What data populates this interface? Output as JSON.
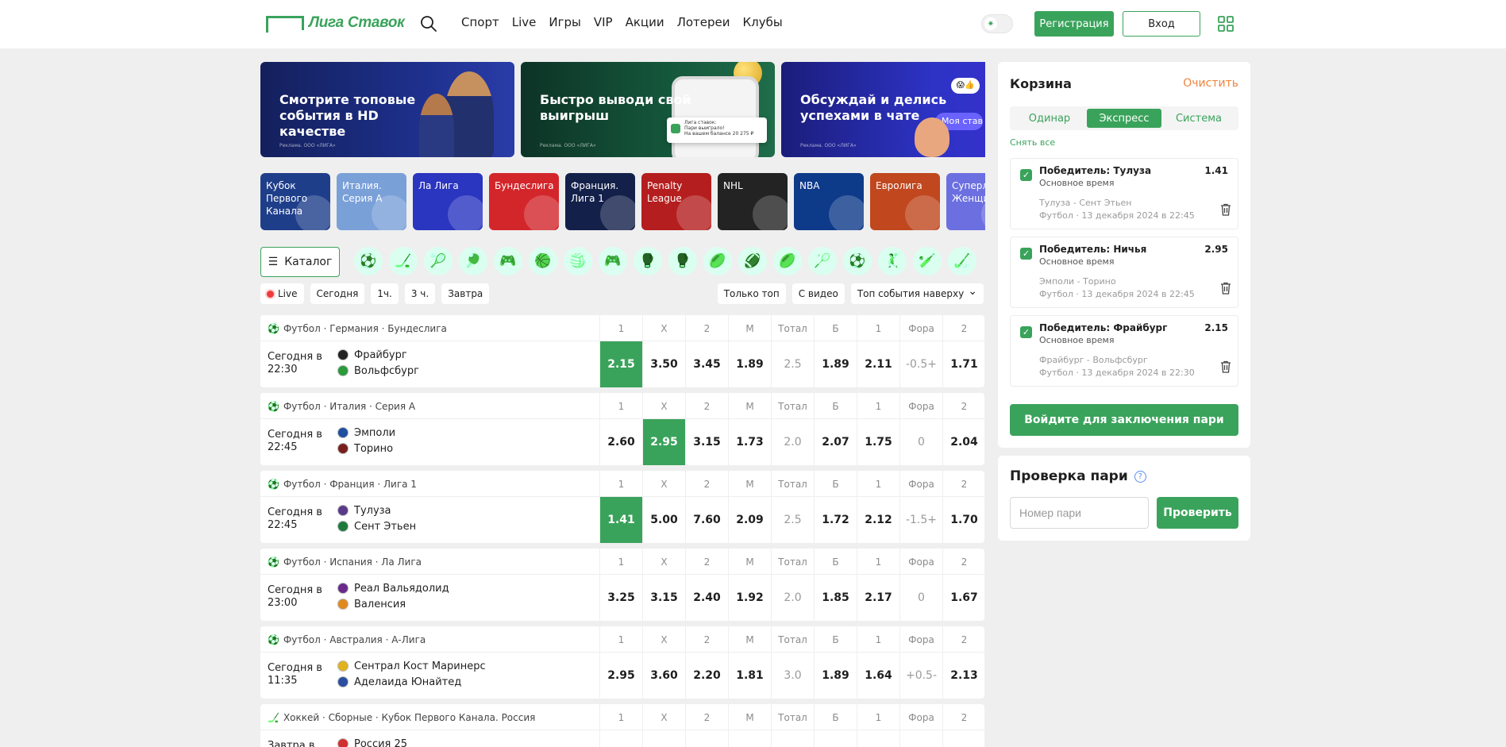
{
  "brand": {
    "logo_text": "Лига Ставок",
    "accent": "#3aa35b"
  },
  "nav": [
    "Спорт",
    "Live",
    "Игры",
    "VIP",
    "Акции",
    "Лотереи",
    "Клубы"
  ],
  "header": {
    "register": "Регистрация",
    "login": "Вход"
  },
  "banners": [
    {
      "title": "Смотрите топовые события в HD качестве",
      "ad": "Реклама. ООО «ЛИГА»"
    },
    {
      "title": "Быстро выводи свой выигрыш",
      "ad": "Реклама. ООО «ЛИГА»",
      "card": [
        "Лига ставок:",
        "Пари выиграло!",
        "На вашем балансе 20 275 ₽"
      ]
    },
    {
      "title": "Обсуждай и делись успехами в чате",
      "ad": "Реклама. ООО «ЛИГА»",
      "chat": "Моя ставка"
    }
  ],
  "leagues": [
    {
      "name": "Кубок Первого Канала",
      "color": "#1f3e8a"
    },
    {
      "name": "Италия. Серия А",
      "color": "#7aa0d8"
    },
    {
      "name": "Ла Лига",
      "color": "#2a35c0"
    },
    {
      "name": "Бундеслига",
      "color": "#d3262b"
    },
    {
      "name": "Франция. Лига 1",
      "color": "#13204a"
    },
    {
      "name": "Penalty League",
      "color": "#b51e1e"
    },
    {
      "name": "NHL",
      "color": "#232323"
    },
    {
      "name": "NBA",
      "color": "#0e3a8a"
    },
    {
      "name": "Евролига",
      "color": "#c0471e"
    },
    {
      "name": "Суперлига. Женщины",
      "color": "#6b6fe0"
    }
  ],
  "catalog": "Каталог",
  "sport_icons": [
    "football-icon",
    "hockey-icon",
    "tennis-icon",
    "table-tennis-icon",
    "esports-icon",
    "basketball-icon",
    "volleyball-icon",
    "gamepad-icon",
    "mma-icon",
    "boxing-icon",
    "rugby-icon",
    "american-football-icon",
    "aussie-rules-icon",
    "badminton-icon",
    "futsal-icon",
    "handball-icon",
    "cricket-icon",
    "hockey-stick-icon"
  ],
  "filters_left": [
    "Live",
    "Сегодня",
    "1ч.",
    "3 ч.",
    "Завтра"
  ],
  "filters_right": [
    "Только топ",
    "С видео",
    "Топ события наверху"
  ],
  "columns": [
    "1",
    "X",
    "2",
    "М",
    "Тотал",
    "Б",
    "1",
    "Фора",
    "2"
  ],
  "events": [
    {
      "league": "Футбол · Германия · Бундеслига",
      "time": "Сегодня в 22:30",
      "home": "Фрайбург",
      "away": "Вольфсбург",
      "odds": [
        "2.15",
        "3.50",
        "3.45",
        "1.89",
        "2.5",
        "1.89",
        "2.11",
        "-0.5+",
        "1.71"
      ],
      "selected": 0
    },
    {
      "league": "Футбол · Италия · Серия А",
      "time": "Сегодня в 22:45",
      "home": "Эмполи",
      "away": "Торино",
      "odds": [
        "2.60",
        "2.95",
        "3.15",
        "1.73",
        "2.0",
        "2.07",
        "1.75",
        "0",
        "2.04"
      ],
      "selected": 1
    },
    {
      "league": "Футбол · Франция · Лига 1",
      "time": "Сегодня в 22:45",
      "home": "Тулуза",
      "away": "Сент Этьен",
      "odds": [
        "1.41",
        "5.00",
        "7.60",
        "2.09",
        "2.5",
        "1.72",
        "2.12",
        "-1.5+",
        "1.70"
      ],
      "selected": 0
    },
    {
      "league": "Футбол · Испания · Ла Лига",
      "time": "Сегодня в 23:00",
      "home": "Реал Вальядолид",
      "away": "Валенсия",
      "odds": [
        "3.25",
        "3.15",
        "2.40",
        "1.92",
        "2.0",
        "1.85",
        "2.17",
        "0",
        "1.67"
      ],
      "selected": -1
    },
    {
      "league": "Футбол · Австралия · А-Лига",
      "time": "Сегодня в 11:35",
      "home": "Сентрал Кост Маринерс",
      "away": "Аделаида Юнайтед",
      "odds": [
        "2.95",
        "3.60",
        "2.20",
        "1.81",
        "3.0",
        "1.89",
        "1.64",
        "+0.5-",
        "2.13"
      ],
      "selected": -1
    },
    {
      "league": "Хоккей · Сборные · Кубок Первого Канала. Россия",
      "time": "Завтра в",
      "home": "Россия 25",
      "away": "",
      "odds": [
        "",
        "",
        "",
        "",
        "",
        "",
        "",
        "",
        ""
      ],
      "selected": -1,
      "sport": "hockey"
    }
  ],
  "betslip": {
    "title": "Корзина",
    "clear": "Очистить",
    "tabs": [
      "Одинар",
      "Экспресс",
      "Система"
    ],
    "active_tab": 1,
    "unselect_all": "Снять все",
    "bets": [
      {
        "name": "Победитель: Тулуза",
        "odd": "1.41",
        "sub": "Основное время",
        "match": "Тулуза - Сент Этьен",
        "info": "Футбол · 13 декабря 2024 в 22:45"
      },
      {
        "name": "Победитель: Ничья",
        "odd": "2.95",
        "sub": "Основное время",
        "match": "Эмполи - Торино",
        "info": "Футбол · 13 декабря 2024 в 22:45"
      },
      {
        "name": "Победитель: Фрайбург",
        "odd": "2.15",
        "sub": "Основное время",
        "match": "Фрайбург - Вольфсбург",
        "info": "Футбол · 13 декабря 2024 в 22:30"
      }
    ],
    "login_button": "Войдите для заключения пари"
  },
  "bet_check": {
    "title": "Проверка пари",
    "placeholder": "Номер пари",
    "button": "Проверить"
  }
}
